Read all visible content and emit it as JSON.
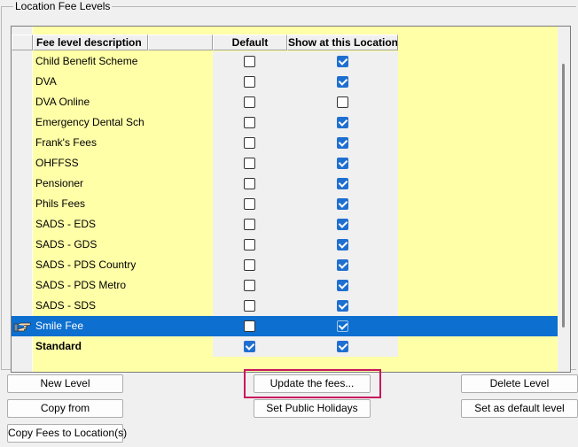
{
  "groupbox": {
    "title": "Location Fee Levels"
  },
  "table": {
    "columns": {
      "description": "Fee level description",
      "default": "Default",
      "show": "Show at this Location"
    },
    "rows": [
      {
        "description": "Child Benefit Scheme",
        "default": false,
        "show": true,
        "selected": false,
        "bold": false
      },
      {
        "description": "DVA",
        "default": false,
        "show": true,
        "selected": false,
        "bold": false
      },
      {
        "description": "DVA Online",
        "default": false,
        "show": false,
        "selected": false,
        "bold": false
      },
      {
        "description": "Emergency Dental Sch",
        "default": false,
        "show": true,
        "selected": false,
        "bold": false
      },
      {
        "description": "Frank's Fees",
        "default": false,
        "show": true,
        "selected": false,
        "bold": false
      },
      {
        "description": "OHFFSS",
        "default": false,
        "show": true,
        "selected": false,
        "bold": false
      },
      {
        "description": "Pensioner",
        "default": false,
        "show": true,
        "selected": false,
        "bold": false
      },
      {
        "description": "Phils Fees",
        "default": false,
        "show": true,
        "selected": false,
        "bold": false
      },
      {
        "description": "SADS - EDS",
        "default": false,
        "show": true,
        "selected": false,
        "bold": false
      },
      {
        "description": "SADS - GDS",
        "default": false,
        "show": true,
        "selected": false,
        "bold": false
      },
      {
        "description": "SADS - PDS Country",
        "default": false,
        "show": true,
        "selected": false,
        "bold": false
      },
      {
        "description": "SADS - PDS Metro",
        "default": false,
        "show": true,
        "selected": false,
        "bold": false
      },
      {
        "description": "SADS - SDS",
        "default": false,
        "show": true,
        "selected": false,
        "bold": false
      },
      {
        "description": "Smile Fee",
        "default": false,
        "show": true,
        "selected": true,
        "bold": false
      },
      {
        "description": "Standard",
        "default": true,
        "show": true,
        "selected": false,
        "bold": true
      }
    ],
    "row_indicator_icon": "pointing-hand-icon"
  },
  "buttons": {
    "new_level": "New Level",
    "update_fees": "Update the fees...",
    "delete_level": "Delete Level",
    "copy_from": "Copy from",
    "set_public_holidays": "Set Public Holidays",
    "set_default_level": "Set as default level",
    "copy_fees_to_location": "Copy Fees to Location(s)"
  },
  "colors": {
    "row_background": "#ffffa8",
    "selection": "#0d6fcf",
    "checkbox_checked": "#1f6fd0",
    "highlight_box": "#c8175d"
  }
}
